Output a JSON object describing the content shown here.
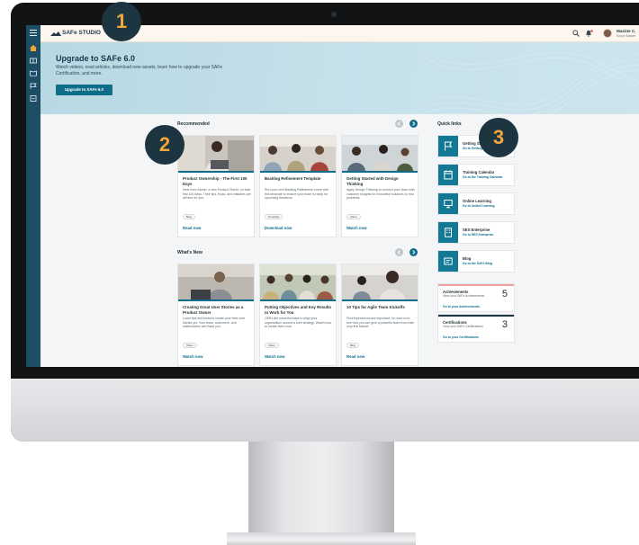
{
  "topbar": {
    "logo": "SAFe STUDIO",
    "user": {
      "name": "Maxine C.",
      "role": "Scrum Master"
    }
  },
  "hero": {
    "title": "Upgrade to SAFe 6.0",
    "description": "Watch videos, read articles, download new assets, learn how to upgrade your SAFe Certification, and more.",
    "button": "Upgrade to SAFe 6.0"
  },
  "sections": {
    "recommended": {
      "title": "Recommended",
      "cards": [
        {
          "title": "Product Ownership - The First 100 Days",
          "description": "Hear from Jackie, a new Product Owner, on their first 100 days. Their tips, tricks, and mistakes are all here for you.",
          "tag": "Blog",
          "link": "Read now"
        },
        {
          "title": "Backlog Refinement Template",
          "description": "Run your next Backlog Refinement event with this template to ensure your team is ready for upcoming Iterations.",
          "tag": "Template",
          "link": "Download now"
        },
        {
          "title": "Getting Started with Design Thinking",
          "description": "Apply Design Thinking to connect your team with customer insights for innovative solutions to real problems.",
          "tag": "Video",
          "link": "Watch now"
        }
      ]
    },
    "whats_new": {
      "title": "What's New",
      "cards": [
        {
          "title": "Creating Great User Stories as a Product Owner",
          "description": "Learn tips and tricks to create your best user stories yet. Your team, customers, and stakeholders will thank you.",
          "tag": "Video",
          "link": "Watch now"
        },
        {
          "title": "Putting Objectives and Key Results to Work for You",
          "description": "OKRs are powerful ways to align your organization around a core strategy. Watch how to create them now.",
          "tag": "Video",
          "link": "Watch now"
        },
        {
          "title": "10 Tips for Agile Team Kickoffs",
          "description": "First impressions are important, so read on to see how you can give a powerful team from their very first kickoff.",
          "tag": "Blog",
          "link": "Read now"
        }
      ]
    }
  },
  "quick_links": {
    "title": "Quick links",
    "items": [
      {
        "title": "Getting Started",
        "link": "Go to Getting Started",
        "icon": "flag-icon"
      },
      {
        "title": "Training Calendar",
        "link": "Go to the Training Calendar",
        "icon": "calendar-icon"
      },
      {
        "title": "Online Learning",
        "link": "Go to Online Learning",
        "icon": "monitor-icon"
      },
      {
        "title": "SES Enterprise",
        "link": "Go to SES Enterprise",
        "icon": "building-icon"
      },
      {
        "title": "Blog",
        "link": "Go to the SAFe Blog",
        "icon": "blog-icon"
      }
    ]
  },
  "stats": {
    "achievements": {
      "title": "Achievements",
      "subtitle": "View your SAFe Achievements",
      "count": "5",
      "link": "Go to your Achievements"
    },
    "certifications": {
      "title": "Certifications",
      "subtitle": "View your SAFe Certifications",
      "count": "3",
      "link": "Go to your Certifications"
    }
  },
  "callouts": [
    "1",
    "2",
    "3"
  ],
  "colors": {
    "accent": "#0f6d8a",
    "rail": "#1e4d66",
    "callout_bg": "#1d3441",
    "callout_text": "#f3a73a",
    "achievements_bar": "#f0a0a0",
    "certifications_bar": "#1d3441"
  }
}
